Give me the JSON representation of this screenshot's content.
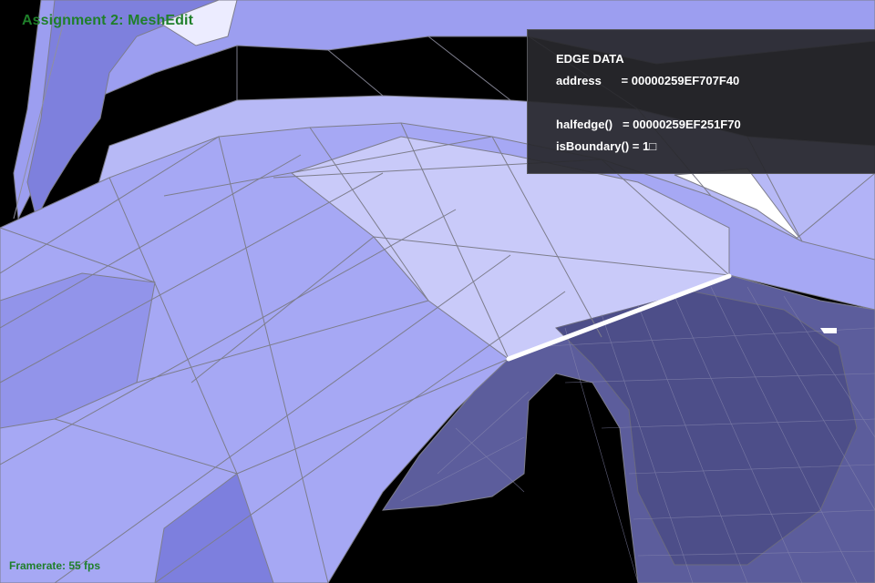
{
  "app": {
    "title": "Assignment 2: MeshEdit"
  },
  "status": {
    "framerate": "Framerate: 55 fps"
  },
  "edge_panel": {
    "header": "EDGE DATA",
    "address_line": "address      = 00000259EF707F40",
    "halfedge_line": "halfedge()   = 00000259EF251F70",
    "boundary_line": "isBoundary() = 1□"
  },
  "colors": {
    "background": "#000000",
    "mesh_face": "#a9abf5",
    "mesh_face_light": "#c8c9f8",
    "mesh_face_dark": "#6e6fc9",
    "mesh_edge": "#7d7d8c",
    "selected_edge": "#ffffff",
    "title_text": "#1f7f2a"
  }
}
